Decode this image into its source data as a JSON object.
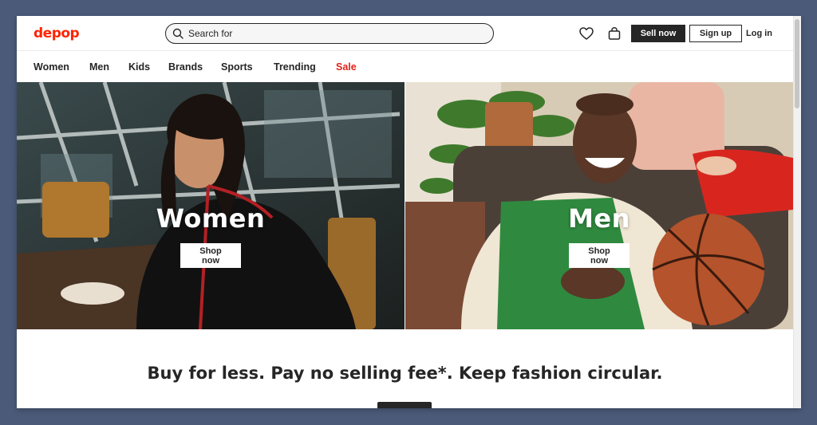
{
  "header": {
    "logo": "depop",
    "search_placeholder": "Search for",
    "sell_label": "Sell now",
    "signup_label": "Sign up",
    "login_label": "Log in"
  },
  "nav": {
    "items": [
      "Women",
      "Men",
      "Kids",
      "Brands",
      "Sports",
      "Trending",
      "Sale"
    ]
  },
  "hero": {
    "left": {
      "title": "Women",
      "cta": "Shop now"
    },
    "right": {
      "title": "Men",
      "cta": "Shop now"
    }
  },
  "tagline": "Buy for less. Pay no selling fee*. Keep fashion circular.",
  "colors": {
    "brand": "#ff2300",
    "sale": "#e2231a",
    "ink": "#262626",
    "frame": "#4a5a78"
  },
  "icons": {
    "search": "search-icon",
    "heart": "heart-icon",
    "bag": "bag-icon"
  }
}
